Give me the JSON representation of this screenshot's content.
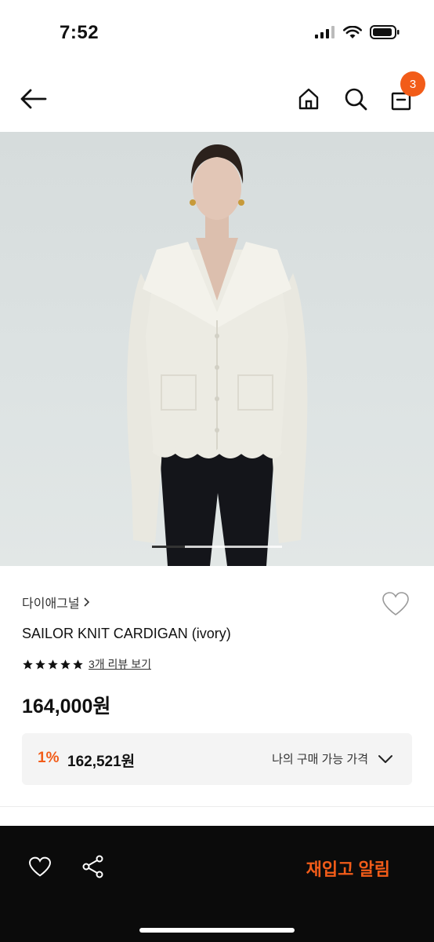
{
  "status": {
    "time": "7:52"
  },
  "header": {
    "cart_count": "3",
    "icons": [
      "back-arrow-icon",
      "home-icon",
      "search-icon",
      "shopping-bag-icon"
    ]
  },
  "product": {
    "brand": "다이애그널",
    "name": "SAILOR KNIT CARDIGAN (ivory)",
    "review_link": "3개 리뷰 보기",
    "rating": 5,
    "price": "164,000원",
    "member_discount": "1%",
    "member_price": "162,521원",
    "purchasable_label": "나의 구매 가능 가격"
  },
  "carousel": {
    "current": 1
  },
  "bottom": {
    "restock_label": "재입고 알림"
  },
  "colors": {
    "accent": "#f25c19",
    "bottom_bar": "#0b0b0b"
  }
}
